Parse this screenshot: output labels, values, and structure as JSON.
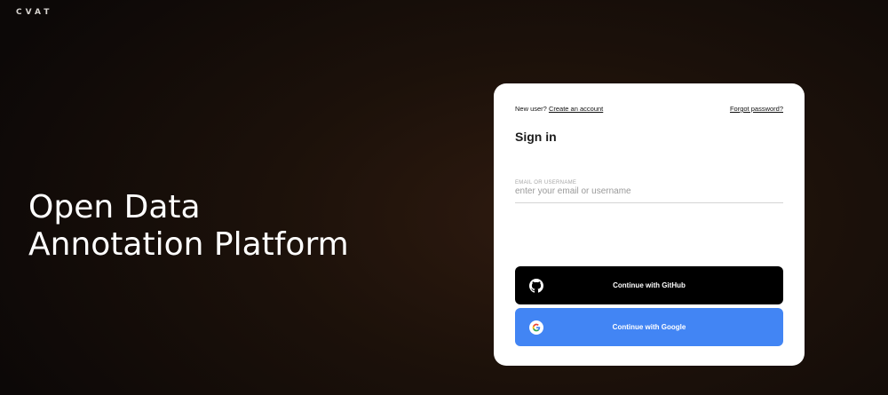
{
  "brand": {
    "logo_text": "CVAT"
  },
  "hero": {
    "line1": "Open Data",
    "line2": "Annotation Platform"
  },
  "signin": {
    "new_user_text": "New user?",
    "create_account_link": "Create an account",
    "forgot_password_link": "Forgot password?",
    "title": "Sign in",
    "email_label": "EMAIL OR USERNAME",
    "email_placeholder": "enter your email or username",
    "email_value": "",
    "github_button": "Continue with GitHub",
    "google_button": "Continue with Google"
  },
  "icons": {
    "github": "github-icon",
    "google": "google-icon"
  },
  "colors": {
    "github_button": "#000000",
    "google_button": "#4285f4",
    "card": "#ffffff"
  }
}
